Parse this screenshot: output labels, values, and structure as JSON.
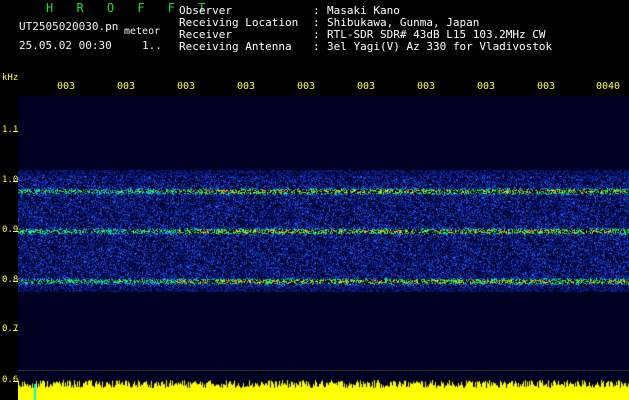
{
  "header": {
    "brand": "H R O F F T",
    "filename": "UT2505020030.pn",
    "file_tag": "meteor",
    "timestamp": "25.05.02 00:30",
    "timestamp_suffix": "1..",
    "info": [
      {
        "label": "Observer",
        "value": "Masaki Kano"
      },
      {
        "label": "Receiving Location",
        "value": "Shibukawa, Gunma, Japan"
      },
      {
        "label": "Receiver",
        "value": "RTL-SDR SDR# 43dB L15 103.2MHz CW"
      },
      {
        "label": "Receiving Antenna",
        "value": "3el Yagi(V) Az 330 for Vladivostok"
      }
    ],
    "separator": ":"
  },
  "axis": {
    "y_unit": "kHz",
    "y_ticks": [
      "1.1",
      "1.0",
      "0.9",
      "0.8",
      "0.7",
      "0.6"
    ],
    "x_ticks": [
      "003",
      "003",
      "003",
      "003",
      "003",
      "003",
      "003",
      "003",
      "003",
      "0040"
    ]
  },
  "spectrogram": {
    "freq_range_khz": [
      0.6,
      1.15
    ],
    "signal_band_khz": [
      0.79,
      1.01
    ],
    "strong_lines_khz": [
      0.8,
      0.9,
      0.98
    ],
    "palette": [
      "#000022",
      "#0a1e8c",
      "#1e5aff",
      "#00dcdc",
      "#00ff30",
      "#ffd000",
      "#ff2040"
    ],
    "power_trace_color": "#ffff00",
    "accent_yellow": "#ffff33"
  }
}
